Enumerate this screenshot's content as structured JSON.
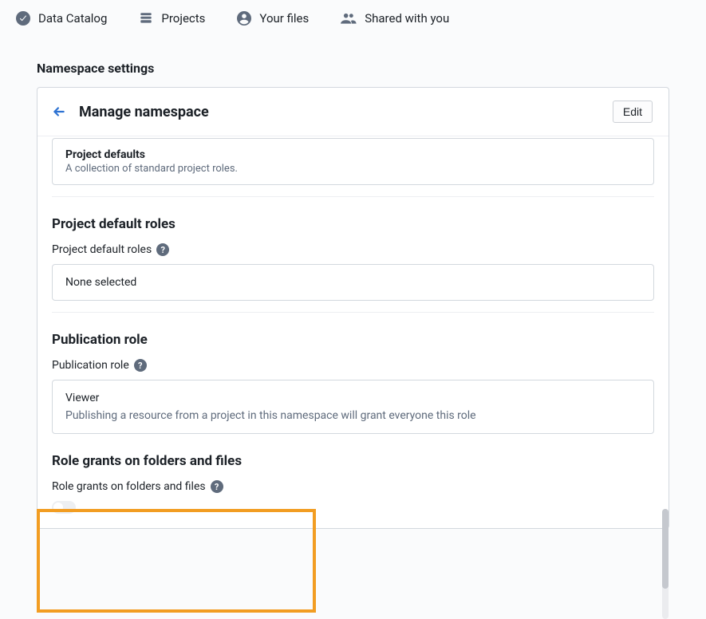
{
  "nav": {
    "catalog": "Data Catalog",
    "projects": "Projects",
    "files": "Your files",
    "shared": "Shared with you"
  },
  "page": {
    "title": "Namespace settings"
  },
  "panel": {
    "title": "Manage namespace",
    "edit_label": "Edit"
  },
  "defaults_card": {
    "title": "Project defaults",
    "subtitle": "A collection of standard project roles."
  },
  "project_roles": {
    "heading": "Project default roles",
    "label": "Project default roles",
    "value": "None selected"
  },
  "publication": {
    "heading": "Publication role",
    "label": "Publication role",
    "role": "Viewer",
    "description": "Publishing a resource from a project in this namespace will grant everyone this role"
  },
  "role_grants": {
    "heading": "Role grants on folders and files",
    "label": "Role grants on folders and files"
  }
}
